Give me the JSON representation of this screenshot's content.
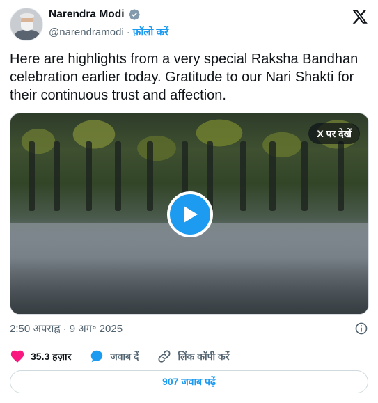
{
  "author": {
    "name": "Narendra Modi",
    "handle": "@narendramodi",
    "separator": "·",
    "follow_label": "फ़ॉलो करें",
    "verified_icon": "verified-badge-icon"
  },
  "brand": {
    "logo": "x-logo-icon"
  },
  "tweet": {
    "text": "Here are highlights from a very special Raksha Bandhan celebration earlier today. Gratitude to our Nari Shakti for their continuous trust and affection."
  },
  "media": {
    "watch_label": "X पर देखें",
    "play_icon": "play-icon"
  },
  "meta": {
    "time": "2:50 अपराह्न",
    "separator": "·",
    "date": "9 अग॰ 2025",
    "info_icon": "info-icon"
  },
  "actions": {
    "likes": "35.3 हज़ार",
    "reply_label": "जवाब दें",
    "copy_link_label": "लिंक कॉपी करें"
  },
  "replies_button": "907 जवाब पढ़ें",
  "colors": {
    "accent": "#1d9bf0",
    "like": "#f91880",
    "text": "#0f1419",
    "muted": "#536471"
  }
}
